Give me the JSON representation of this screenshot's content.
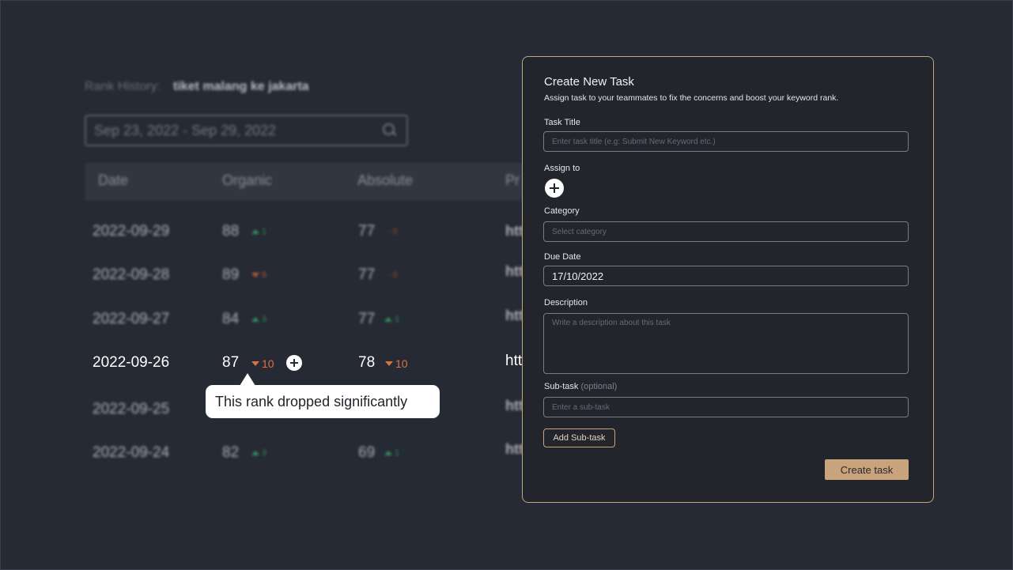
{
  "rank_history": {
    "label": "Rank History:",
    "keyword": "tiket malang ke jakarta",
    "date_range": "Sep 23, 2022 - Sep 29, 2022",
    "columns": [
      "Date",
      "Organic",
      "Absolute",
      "Pr"
    ],
    "rows": [
      {
        "date": "2022-09-29",
        "organic": "88",
        "organic_change": "1",
        "organic_dir": "up",
        "absolute": "77",
        "absolute_change": "0",
        "absolute_dir": "none",
        "prev": "htt"
      },
      {
        "date": "2022-09-28",
        "organic": "89",
        "organic_change": "5",
        "organic_dir": "down",
        "absolute": "77",
        "absolute_change": "0",
        "absolute_dir": "none",
        "prev": "htt"
      },
      {
        "date": "2022-09-27",
        "organic": "84",
        "organic_change": "3",
        "organic_dir": "up",
        "absolute": "77",
        "absolute_change": "1",
        "absolute_dir": "up",
        "prev": "htt"
      },
      {
        "date": "2022-09-25",
        "organic": "",
        "organic_change": "",
        "organic_dir": "none",
        "absolute": "",
        "absolute_change": "",
        "absolute_dir": "none",
        "prev": "htt"
      },
      {
        "date": "2022-09-24",
        "organic": "82",
        "organic_change": "3",
        "organic_dir": "up",
        "absolute": "69",
        "absolute_change": "1",
        "absolute_dir": "up",
        "prev": "htt"
      }
    ],
    "focus_row": {
      "date": "2022-09-26",
      "organic": "87",
      "organic_change": "10",
      "absolute": "78",
      "absolute_change": "10",
      "prev": "htt"
    },
    "tooltip": "This rank dropped significantly"
  },
  "modal": {
    "title": "Create New Task",
    "subtitle": "Assign task to your teammates to fix the concerns and boost your keyword rank.",
    "task_title_label": "Task Title",
    "task_title_placeholder": "Enter task title (e.g: Submit New Keyword etc.)",
    "assign_label": "Assign to",
    "category_label": "Category",
    "category_placeholder": "Select category",
    "due_date_label": "Due Date",
    "due_date_value": "17/10/2022",
    "description_label": "Description",
    "description_placeholder": "Write a description about this task",
    "subtask_label": "Sub-task",
    "subtask_optional": "(optional)",
    "subtask_placeholder": "Enter a sub-task",
    "add_subtask_label": "Add Sub-task",
    "create_label": "Create task"
  },
  "colors": {
    "background": "#262a34",
    "modal_bg": "#22252c",
    "accent": "#c9a37b",
    "up": "#3fae6a",
    "down": "#e0713f"
  }
}
